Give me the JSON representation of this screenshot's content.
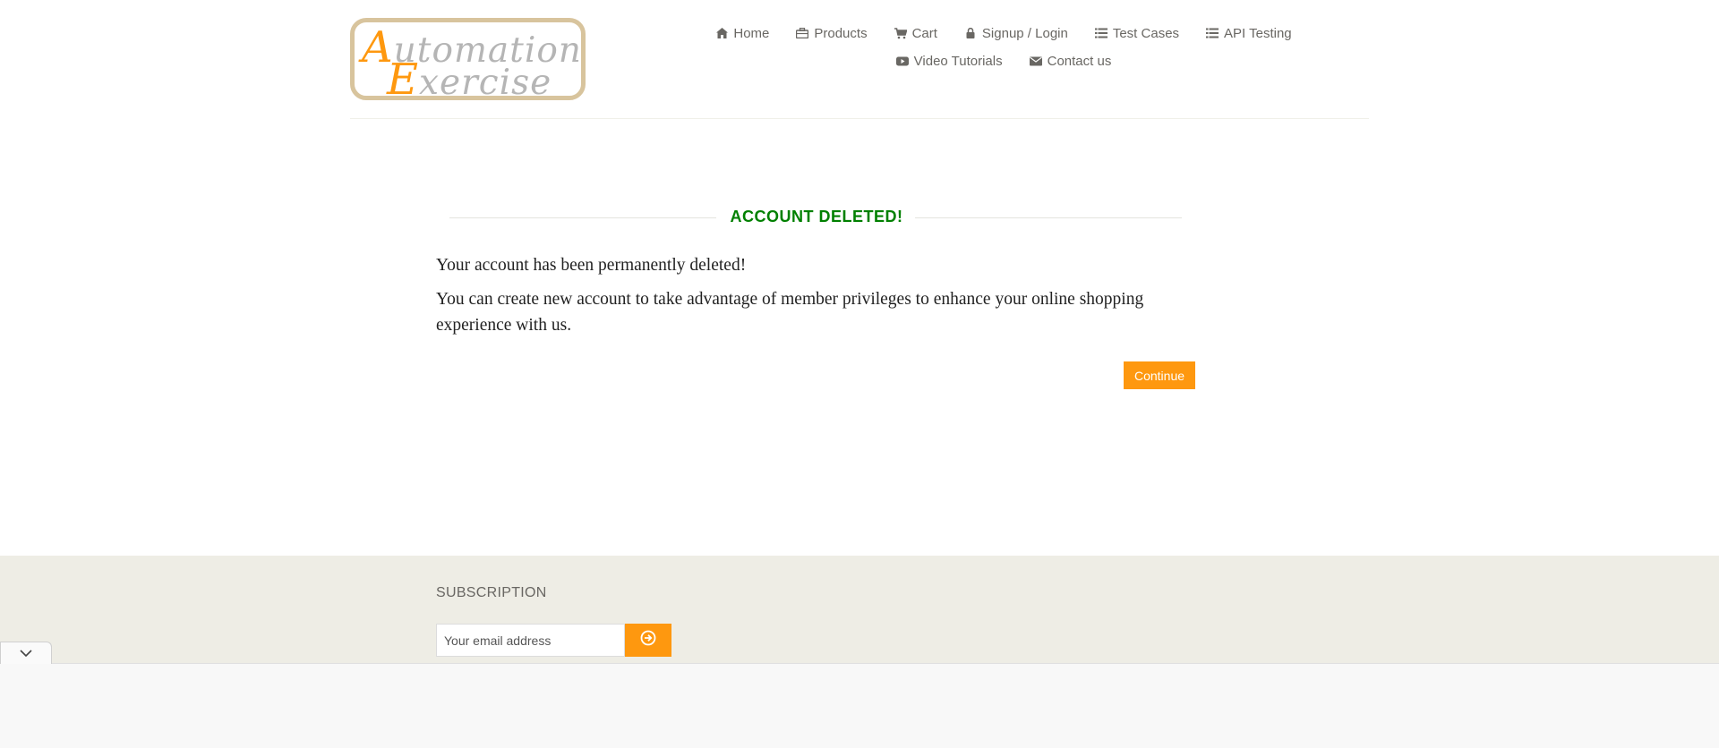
{
  "brand": {
    "logo_line1_cap": "A",
    "logo_line1_rest": "utomation",
    "logo_line2_cap": "E",
    "logo_line2_rest": "xercise"
  },
  "nav": {
    "row1": [
      {
        "label": "Home",
        "icon": "home-icon"
      },
      {
        "label": "Products",
        "icon": "briefcase-icon"
      },
      {
        "label": "Cart",
        "icon": "cart-icon"
      },
      {
        "label": "Signup / Login",
        "icon": "lock-icon"
      },
      {
        "label": "Test Cases",
        "icon": "list-icon"
      },
      {
        "label": "API Testing",
        "icon": "list-icon"
      }
    ],
    "row2": [
      {
        "label": "Video Tutorials",
        "icon": "youtube-icon"
      },
      {
        "label": "Contact us",
        "icon": "envelope-icon"
      }
    ]
  },
  "main": {
    "title": "ACCOUNT DELETED!",
    "message1": "Your account has been permanently deleted!",
    "message2": "You can create new account to take advantage of member privileges to enhance your online shopping experience with us.",
    "continue_label": "Continue"
  },
  "footer": {
    "subscription_title": "SUBSCRIPTION",
    "email_placeholder": "Your email address"
  },
  "colors": {
    "accent": "#fe980f",
    "success": "#008000",
    "footer_bg": "#eeede5",
    "text": "#696763"
  }
}
